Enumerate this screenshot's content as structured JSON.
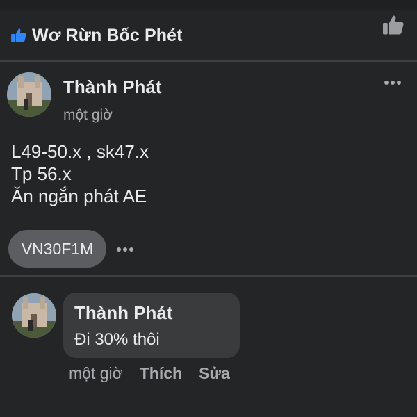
{
  "group": {
    "name": "Wơ Rừn Bốc Phét",
    "left_icon": "thumbs-up-icon",
    "right_icon": "thumbs-up-icon",
    "accent_color": "#2d88ff"
  },
  "post": {
    "author": "Thành Phát",
    "time": "một giờ",
    "lines": [
      "L49-50.x , sk47.x",
      "Tp 56.x",
      "Ăn ngắn phát AE"
    ],
    "tag": "VN30F1M",
    "more_icon": "more-horizontal-icon"
  },
  "comment": {
    "author": "Thành Phát",
    "text": "Đi 30% thôi",
    "time": "một giờ",
    "like_label": "Thích",
    "edit_label": "Sửa"
  }
}
